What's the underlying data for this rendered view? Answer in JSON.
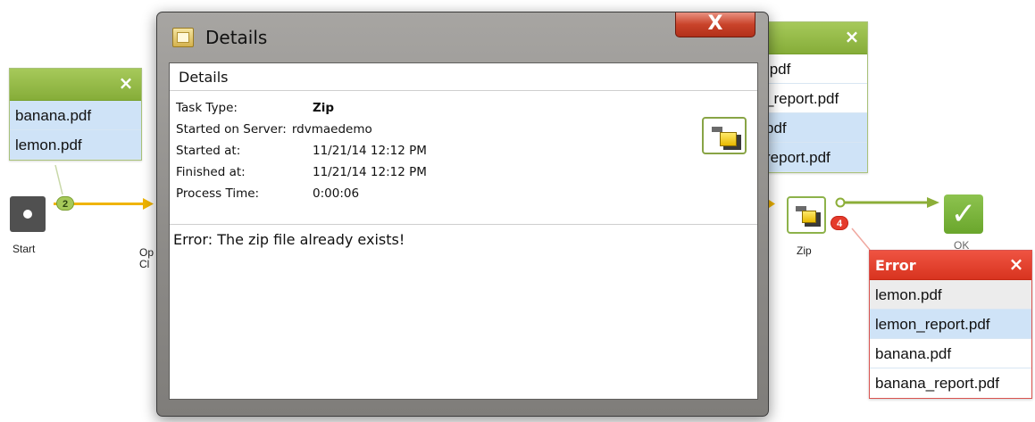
{
  "dialog": {
    "title": "Details",
    "close_label": "X",
    "section_title": "Details",
    "fields": [
      {
        "label": "Task Type:",
        "value": "Zip",
        "bold": true
      },
      {
        "label": "Started on Server:",
        "value": "rdvmaedemo",
        "bold": false
      },
      {
        "label": "Started at:",
        "value": "11/21/14 12:12 PM",
        "bold": false
      },
      {
        "label": "Finished at:",
        "value": "11/21/14 12:12 PM",
        "bold": false
      },
      {
        "label": "Process Time:",
        "value": "0:00:06",
        "bold": false
      }
    ],
    "task_icon": "zip-task-icon",
    "error_message": "Error: The zip file already exists!"
  },
  "workflow": {
    "left_panel": {
      "close_label": "×",
      "files": [
        "banana.pdf",
        "lemon.pdf"
      ]
    },
    "start_node": {
      "label": "Start"
    },
    "start_badge": "2",
    "partial_node_label_1": "Op",
    "partial_node_label_2": "Cl",
    "right_panel": {
      "close_label": "×",
      "files": [
        ".pdf",
        "_report.pdf",
        "pdf",
        "report.pdf"
      ]
    },
    "zip_node": {
      "label": "Zip"
    },
    "zip_badge": "4",
    "ok_node_label": "OK",
    "ok_symbol": "✓",
    "error_panel": {
      "title": "Error",
      "close_label": "×",
      "files": [
        "lemon.pdf",
        "lemon_report.pdf",
        "banana.pdf",
        "banana_report.pdf"
      ]
    }
  },
  "colors": {
    "green_header": "#86ad39",
    "selected_row": "#cfe3f7",
    "error_red": "#e53b2c",
    "connector_orange": "#f0b400",
    "connector_green": "#8cae38"
  }
}
